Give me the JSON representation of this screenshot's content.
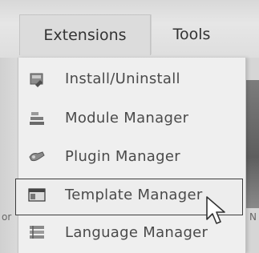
{
  "menubar": {
    "tabs": [
      {
        "label": "Extensions"
      },
      {
        "label": "Tools"
      }
    ]
  },
  "dropdown": {
    "items": [
      {
        "label": "Install/Uninstall",
        "icon": "install-icon"
      },
      {
        "label": "Module Manager",
        "icon": "module-icon"
      },
      {
        "label": "Plugin Manager",
        "icon": "plugin-icon"
      },
      {
        "label": "Template Manager",
        "icon": "template-icon",
        "selected": true
      },
      {
        "label": "Language Manager",
        "icon": "language-icon"
      }
    ]
  },
  "background_fragments": {
    "left": "or",
    "right": "N"
  }
}
